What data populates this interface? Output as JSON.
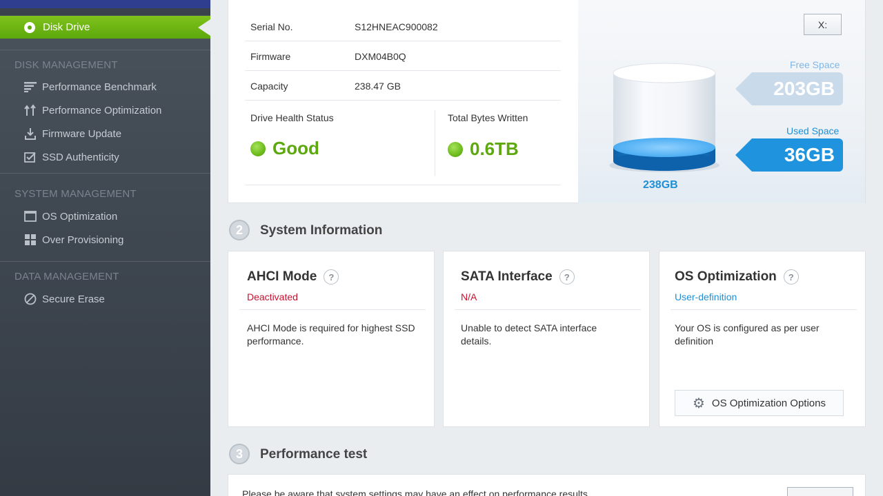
{
  "sidebar": {
    "active_item": "Disk Drive",
    "sections": [
      {
        "title": "DISK MANAGEMENT",
        "items": [
          "Performance Benchmark",
          "Performance Optimization",
          "Firmware Update",
          "SSD Authenticity"
        ]
      },
      {
        "title": "SYSTEM MANAGEMENT",
        "items": [
          "OS Optimization",
          "Over Provisioning"
        ]
      },
      {
        "title": "DATA MANAGEMENT",
        "items": [
          "Secure Erase"
        ]
      }
    ]
  },
  "drive_info": {
    "rows": [
      {
        "key": "Serial No.",
        "value": "S12HNEAC900082"
      },
      {
        "key": "Firmware",
        "value": "DXM04B0Q"
      },
      {
        "key": "Capacity",
        "value": "238.47 GB"
      }
    ],
    "health_label": "Drive Health Status",
    "health_value": "Good",
    "tbw_label": "Total Bytes Written",
    "tbw_value": "0.6TB"
  },
  "storage": {
    "drive_letter": "X:",
    "free_label": "Free Space",
    "free_value": "203GB",
    "used_label": "Used Space",
    "used_value": "36GB",
    "total": "238GB",
    "used_fraction": 0.15
  },
  "system_info": {
    "step": "2",
    "title": "System Information",
    "cards": [
      {
        "title": "AHCI Mode",
        "help": "?",
        "status": "Deactivated",
        "status_color": "#c8102e",
        "desc": "AHCI Mode is required for highest SSD performance."
      },
      {
        "title": "SATA Interface",
        "help": "?",
        "status": "N/A",
        "status_color": "#c8102e",
        "desc": "Unable to detect SATA interface details."
      },
      {
        "title": "OS Optimization",
        "help": "?",
        "status": "User-definition",
        "status_color": "#1e8fd5",
        "desc": "Your OS is configured as per user definition",
        "button": "OS Optimization Options"
      }
    ]
  },
  "performance": {
    "step": "3",
    "title": "Performance test",
    "note": "Please be aware that system settings may have an effect on performance results."
  },
  "colors": {
    "accent_green": "#5da80d",
    "accent_blue": "#1e8fd5",
    "free_tag": "#c9daea",
    "used_tag": "#1f93dd"
  }
}
